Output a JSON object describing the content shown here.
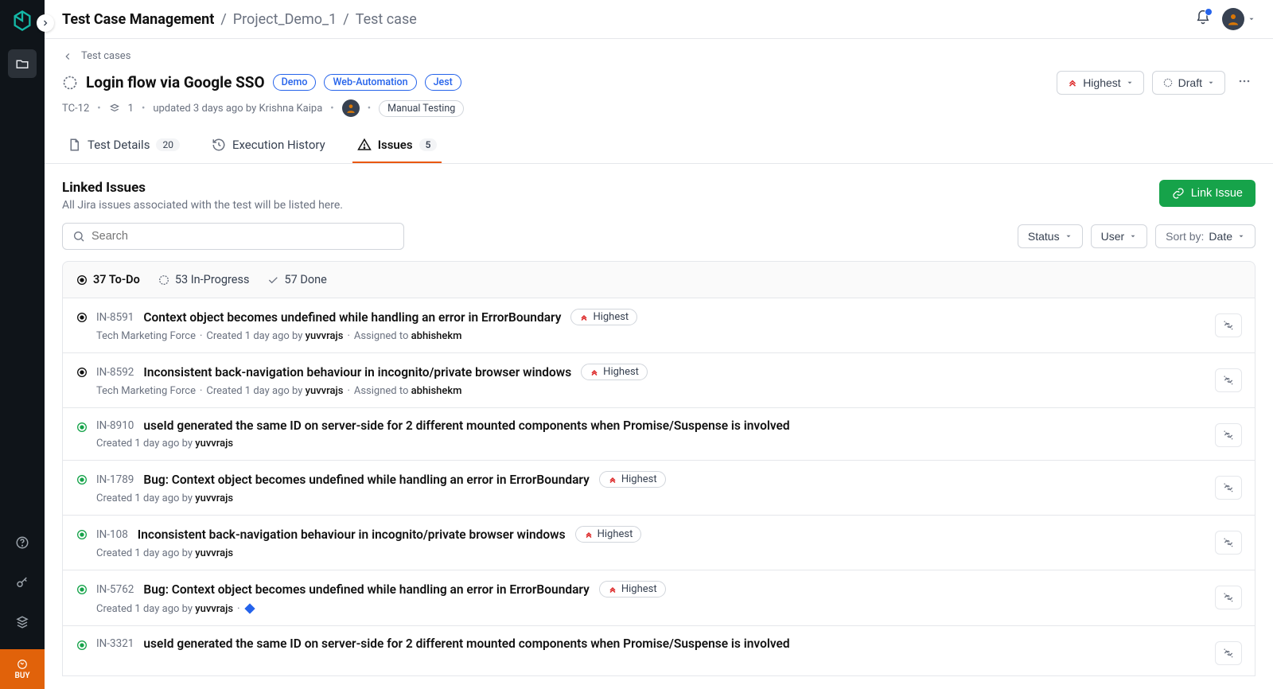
{
  "breadcrumb": {
    "app": "Test Case Management",
    "project": "Project_Demo_1",
    "page": "Test case"
  },
  "back_link": "Test cases",
  "title": "Login flow via Google SSO",
  "tags": [
    "Demo",
    "Web-Automation",
    "Jest"
  ],
  "priority_btn": "Highest",
  "status_btn": "Draft",
  "meta": {
    "id": "TC-12",
    "stack": "1",
    "updated": "updated 3 days ago by Krishna Kaipa",
    "testing_type": "Manual Testing"
  },
  "tabs": {
    "details": {
      "label": "Test Details",
      "count": "20"
    },
    "history": {
      "label": "Execution History"
    },
    "issues": {
      "label": "Issues",
      "count": "5"
    }
  },
  "section": {
    "title": "Linked Issues",
    "subtitle": "All Jira issues associated with the test will be listed here."
  },
  "link_issue_btn": "Link Issue",
  "search_placeholder": "Search",
  "filters": {
    "status": "Status",
    "user": "User",
    "sort_prefix": "Sort by:",
    "sort_value": "Date"
  },
  "status_counts": {
    "todo": "37 To-Do",
    "inprogress": "53 In-Progress",
    "done": "57 Done"
  },
  "issues": [
    {
      "status": "todo",
      "id": "IN-8591",
      "title": "Context object becomes undefined while handling an error in ErrorBoundary",
      "priority": "Highest",
      "project": "Tech Marketing Force",
      "created": "Created 1 day ago by",
      "creator": "yuvvrajs",
      "assigned_prefix": "Assigned to",
      "assignee": "abhishekm",
      "jira": false
    },
    {
      "status": "todo",
      "id": "IN-8592",
      "title": "Inconsistent back-navigation behaviour in incognito/private browser windows",
      "priority": "Highest",
      "project": "Tech Marketing Force",
      "created": "Created 1 day ago by",
      "creator": "yuvvrajs",
      "assigned_prefix": "Assigned to",
      "assignee": "abhishekm",
      "jira": false
    },
    {
      "status": "open",
      "id": "IN-8910",
      "title": "useId generated the same ID on server-side for 2 different mounted components when Promise/Suspense is involved",
      "priority": null,
      "project": null,
      "created": "Created 1 day ago by",
      "creator": "yuvvrajs",
      "assigned_prefix": null,
      "assignee": null,
      "jira": false
    },
    {
      "status": "open",
      "id": "IN-1789",
      "title": "Bug: Context object becomes undefined while handling an error in ErrorBoundary",
      "priority": "Highest",
      "project": null,
      "created": "Created 1 day ago by",
      "creator": "yuvvrajs",
      "assigned_prefix": null,
      "assignee": null,
      "jira": false
    },
    {
      "status": "open",
      "id": "IN-108",
      "title": "Inconsistent back-navigation behaviour in incognito/private browser windows",
      "priority": "Highest",
      "project": null,
      "created": "Created 1 day ago by",
      "creator": "yuvvrajs",
      "assigned_prefix": null,
      "assignee": null,
      "jira": false
    },
    {
      "status": "open",
      "id": "IN-5762",
      "title": "Bug: Context object becomes undefined while handling an error in ErrorBoundary",
      "priority": "Highest",
      "project": null,
      "created": "Created 1 day ago by",
      "creator": "yuvvrajs",
      "assigned_prefix": null,
      "assignee": null,
      "jira": true
    },
    {
      "status": "open",
      "id": "IN-3321",
      "title": "useId generated the same ID on server-side for 2 different mounted components when Promise/Suspense is involved",
      "priority": null,
      "project": null,
      "created": null,
      "creator": null,
      "assigned_prefix": null,
      "assignee": null,
      "jira": false
    }
  ],
  "buy_label": "BUY"
}
